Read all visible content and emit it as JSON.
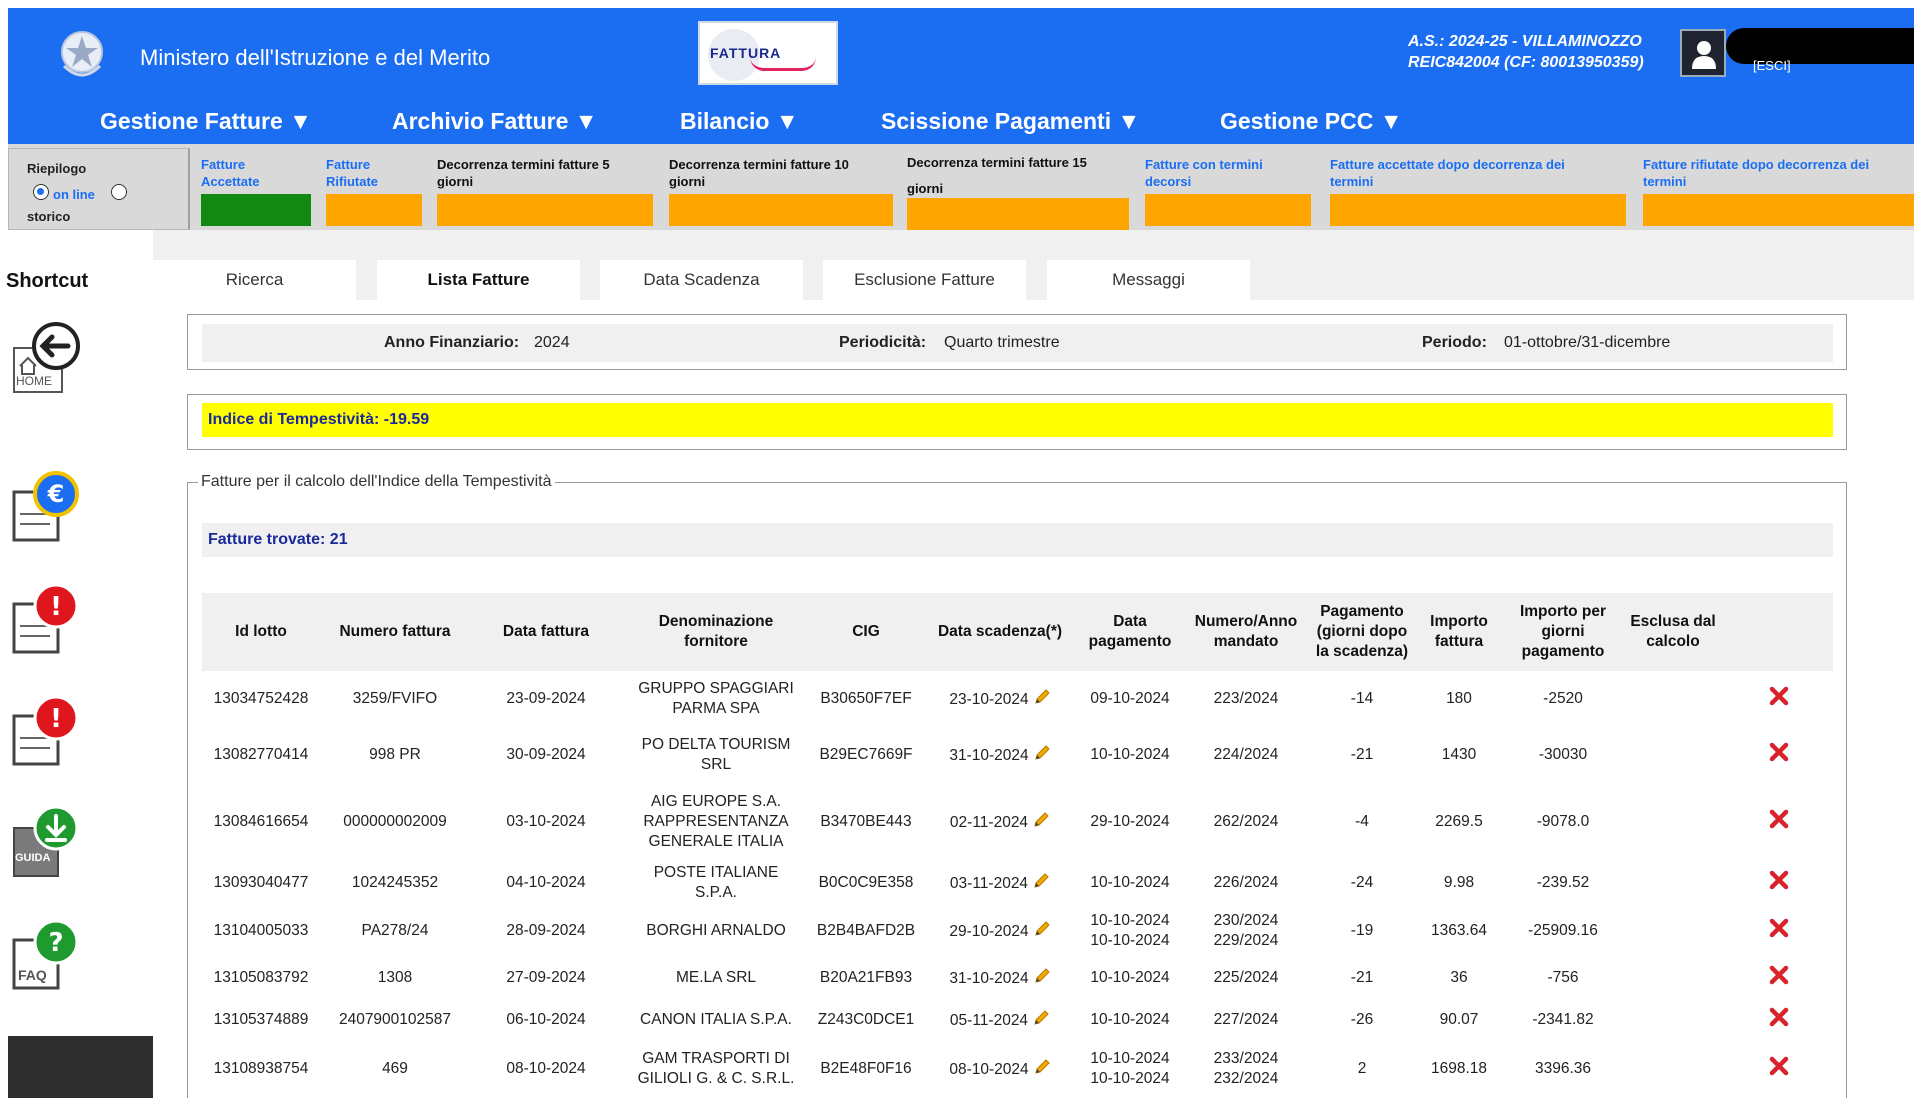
{
  "header": {
    "ministry": "Ministero dell'Istruzione e del Merito",
    "logo_text": "FATTURA",
    "school_line1": "A.S.: 2024-25  - VILLAMINOZZO",
    "school_line2": "REIC842004  (CF: 80013950359)",
    "esci": "[ESCI]"
  },
  "menu": [
    {
      "label": "Gestione Fatture ▼"
    },
    {
      "label": "Archivio Fatture ▼"
    },
    {
      "label": "Bilancio ▼"
    },
    {
      "label": "Scissione Pagamenti ▼"
    },
    {
      "label": "Gestione PCC ▼"
    }
  ],
  "riepilogo": {
    "title": "Riepilogo",
    "online": "on line",
    "storico": "storico",
    "selected": "on line"
  },
  "status_items": [
    {
      "label_line1": "Fatture",
      "label_line2": "Accettate",
      "color": "#128a12"
    },
    {
      "label_line1": "Fatture",
      "label_line2": "Rifiutate",
      "color": "#ffa500"
    },
    {
      "label_line1": "Decorrenza termini fatture 5",
      "label_line2": "giorni",
      "color": "#ffa500"
    },
    {
      "label_line1": "Decorrenza termini fatture 10",
      "label_line2": "giorni",
      "color": "#ffa500"
    },
    {
      "label_line1": "Decorrenza termini fatture 15",
      "label_line2": "giorni",
      "color": "#ffa500"
    },
    {
      "label_line1": "Fatture con termini",
      "label_line2": "decorsi",
      "color": "#ffa500"
    },
    {
      "label_line1": "Fatture accettate dopo decorrenza dei",
      "label_line2": "termini",
      "color": "#ffa500"
    },
    {
      "label_line1": "Fatture rifiutate dopo decorrenza dei",
      "label_line2": "termini",
      "color": "#ffa500"
    }
  ],
  "sidebar": {
    "title": "Shortcut",
    "home_label": "HOME",
    "guida_label": "GUIDA",
    "faq_label": "FAQ"
  },
  "tabs": [
    {
      "label": "Ricerca"
    },
    {
      "label": "Lista Fatture"
    },
    {
      "label": "Data Scadenza"
    },
    {
      "label": "Esclusione Fatture"
    },
    {
      "label": "Messaggi"
    }
  ],
  "active_tab": "Lista Fatture",
  "filters": {
    "anno_label": "Anno Finanziario:",
    "anno_value": "2024",
    "periodicita_label": "Periodicità:",
    "periodicita_value": "Quarto trimestre",
    "periodo_label": "Periodo:",
    "periodo_value": "01-ottobre/31-dicembre"
  },
  "indice": "Indice di Tempestività: -19.59",
  "fieldset_legend": "Fatture per il calcolo dell'Indice della Tempestività",
  "trovate": "Fatture trovate: 21",
  "table": {
    "headers": [
      "Id lotto",
      "Numero fattura",
      "Data fattura",
      "Denominazione fornitore",
      "CIG",
      "Data scadenza(*)",
      "Data pagamento",
      "Numero/Anno mandato",
      "Pagamento (giorni dopo la scadenza)",
      "Importo fattura",
      "Importo per giorni pagamento",
      "Esclusa dal calcolo"
    ],
    "rows": [
      {
        "id_lotto": "13034752428",
        "numero": "3259/FVIFO",
        "data_fattura": "23-09-2024",
        "fornitore": "GRUPPO SPAGGIARI PARMA SPA",
        "cig": "B30650F7EF",
        "scadenza": "23-10-2024",
        "pagamento": "09-10-2024",
        "mandato": "223/2024",
        "giorni": "-14",
        "importo": "180",
        "importo_giorni": "-2520"
      },
      {
        "id_lotto": "13082770414",
        "numero": "998 PR",
        "data_fattura": "30-09-2024",
        "fornitore": "PO DELTA TOURISM SRL",
        "cig": "B29EC7669F",
        "scadenza": "31-10-2024",
        "pagamento": "10-10-2024",
        "mandato": "224/2024",
        "giorni": "-21",
        "importo": "1430",
        "importo_giorni": "-30030"
      },
      {
        "id_lotto": "13084616654",
        "numero": "000000002009",
        "data_fattura": "03-10-2024",
        "fornitore": "AIG EUROPE S.A. RAPPRESENTANZA GENERALE ITALIA",
        "cig": "B3470BE443",
        "scadenza": "02-11-2024",
        "pagamento": "29-10-2024",
        "mandato": "262/2024",
        "giorni": "-4",
        "importo": "2269.5",
        "importo_giorni": "-9078.0"
      },
      {
        "id_lotto": "13093040477",
        "numero": "1024245352",
        "data_fattura": "04-10-2024",
        "fornitore": "POSTE ITALIANE S.P.A.",
        "cig": "B0C0C9E358",
        "scadenza": "03-11-2024",
        "pagamento": "10-10-2024",
        "mandato": "226/2024",
        "giorni": "-24",
        "importo": "9.98",
        "importo_giorni": "-239.52"
      },
      {
        "id_lotto": "13104005033",
        "numero": "PA278/24",
        "data_fattura": "28-09-2024",
        "fornitore": "BORGHI ARNALDO",
        "cig": "B2B4BAFD2B",
        "scadenza": "29-10-2024",
        "pagamento": "10-10-2024 10-10-2024",
        "mandato": "230/2024 229/2024",
        "giorni": "-19",
        "importo": "1363.64",
        "importo_giorni": "-25909.16"
      },
      {
        "id_lotto": "13105083792",
        "numero": "1308",
        "data_fattura": "27-09-2024",
        "fornitore": "ME.LA SRL",
        "cig": "B20A21FB93",
        "scadenza": "31-10-2024",
        "pagamento": "10-10-2024",
        "mandato": "225/2024",
        "giorni": "-21",
        "importo": "36",
        "importo_giorni": "-756"
      },
      {
        "id_lotto": "13105374889",
        "numero": "2407900102587",
        "data_fattura": "06-10-2024",
        "fornitore": "CANON ITALIA S.P.A.",
        "cig": "Z243C0DCE1",
        "scadenza": "05-11-2024",
        "pagamento": "10-10-2024",
        "mandato": "227/2024",
        "giorni": "-26",
        "importo": "90.07",
        "importo_giorni": "-2341.82"
      },
      {
        "id_lotto": "13108938754",
        "numero": "469",
        "data_fattura": "08-10-2024",
        "fornitore": "GAM TRASPORTI DI GILIOLI G. & C. S.R.L.",
        "cig": "B2E48F0F16",
        "scadenza": "08-10-2024",
        "pagamento": "10-10-2024 10-10-2024",
        "mandato": "233/2024 232/2024",
        "giorni": "2",
        "importo": "1698.18",
        "importo_giorni": "3396.36"
      }
    ]
  }
}
